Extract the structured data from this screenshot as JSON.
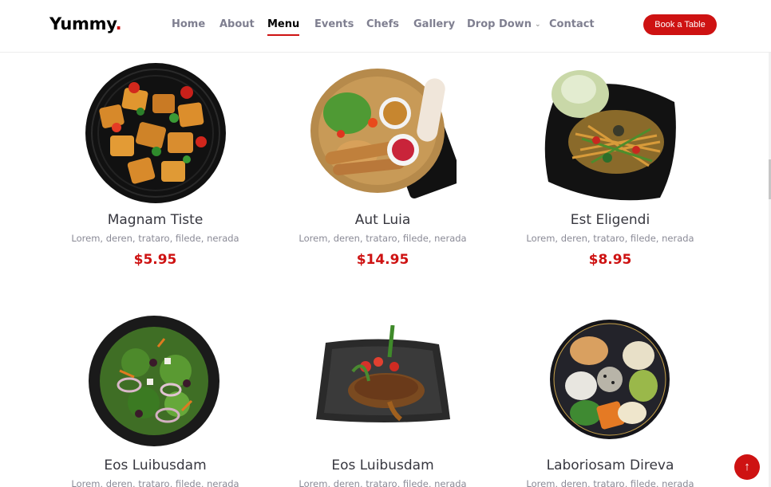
{
  "brand": {
    "name": "Yummy",
    "dot": "."
  },
  "nav": {
    "items": [
      "Home",
      "About",
      "Menu",
      "Events",
      "Chefs",
      "Gallery",
      "Drop Down",
      "Contact"
    ],
    "active": "Menu"
  },
  "header": {
    "cta_label": "Book a Table"
  },
  "menu": [
    {
      "title": "Magnam Tiste",
      "ingredients": "Lorem, deren, trataro, filede, nerada",
      "price": "$5.95"
    },
    {
      "title": "Aut Luia",
      "ingredients": "Lorem, deren, trataro, filede, nerada",
      "price": "$14.95"
    },
    {
      "title": "Est Eligendi",
      "ingredients": "Lorem, deren, trataro, filede, nerada",
      "price": "$8.95"
    },
    {
      "title": "Eos Luibusdam",
      "ingredients": "Lorem, deren, trataro, filede, nerada",
      "price": ""
    },
    {
      "title": "Eos Luibusdam",
      "ingredients": "Lorem, deren, trataro, filede, nerada",
      "price": ""
    },
    {
      "title": "Laboriosam Direva",
      "ingredients": "Lorem, deren, trataro, filede, nerada",
      "price": ""
    }
  ],
  "icons": {
    "dropdown": "chevron-down-icon",
    "scroll_top": "arrow-up-icon"
  },
  "colors": {
    "accent": "#ce1212",
    "text_dark": "#37373f",
    "text_muted": "#7f7f90"
  }
}
